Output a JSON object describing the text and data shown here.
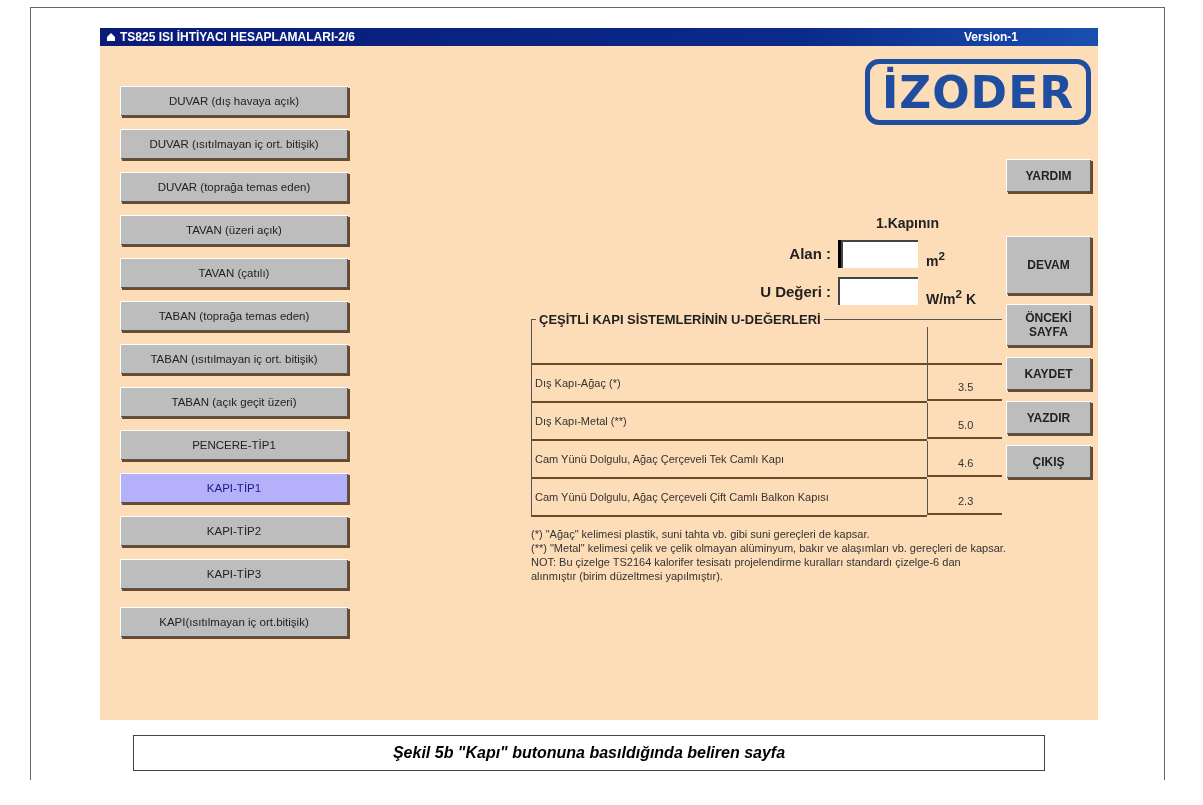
{
  "window": {
    "title": "TS825 ISI İHTİYACI HESAPLAMALARI-2/6",
    "version": "Version-1"
  },
  "logo": {
    "text": "İZODER"
  },
  "nav_buttons": [
    {
      "label": "DUVAR (dış havaya açık)",
      "selected": false
    },
    {
      "label": "DUVAR (ısıtılmayan iç ort. bitişik)",
      "selected": false
    },
    {
      "label": "DUVAR (toprağa temas eden)",
      "selected": false
    },
    {
      "label": "TAVAN (üzeri açık)",
      "selected": false
    },
    {
      "label": "TAVAN (çatılı)",
      "selected": false
    },
    {
      "label": "TABAN (toprağa temas eden)",
      "selected": false
    },
    {
      "label": "TABAN (ısıtılmayan iç ort. bitişik)",
      "selected": false
    },
    {
      "label": "TABAN (açık geçit üzeri)",
      "selected": false
    },
    {
      "label": "PENCERE-TİP1",
      "selected": false
    },
    {
      "label": "KAPI-TİP1",
      "selected": true
    },
    {
      "label": "KAPI-TİP2",
      "selected": false
    },
    {
      "label": "KAPI-TİP3",
      "selected": false
    },
    {
      "label": "KAPI(ısıtılmayan iç ort.bitişik)",
      "selected": false
    }
  ],
  "form": {
    "heading": "1.Kapının",
    "fields": [
      {
        "label": "Alan :",
        "unit": "m$^{2}$",
        "focused": true
      },
      {
        "label": "U Değeri :",
        "unit": "W/m$^{2}$ K",
        "focused": false
      }
    ]
  },
  "u_table": {
    "title": "ÇEŞİTLİ KAPI SİSTEMLERİNİN U-DEĞERLERİ",
    "rows": [
      {
        "name": "Dış Kapı-Ağaç (*)",
        "value": "3.5"
      },
      {
        "name": "Dış Kapı-Metal (**)",
        "value": "5.0"
      },
      {
        "name": "Cam Yünü Dolgulu, Ağaç Çerçeveli Tek Camlı Kapı",
        "value": "4.6"
      },
      {
        "name": "Cam Yünü Dolgulu, Ağaç Çerçeveli Çift Camlı Balkon Kapısı",
        "value": "2.3"
      }
    ],
    "notes": [
      "(*) \"Ağaç\" kelimesi plastik, suni tahta vb. gibi suni gereçleri de kapsar.",
      "(**) \"Metal\" kelimesi çelik ve çelik olmayan alüminyum, bakır ve alaşımları vb. gereçleri de kapsar.",
      "NOT: Bu çizelge TS2164 kalorifer tesisatı projelendirme kuralları standardı çizelge-6 dan alınmıştır (birim düzeltmesi yapılmıştır)."
    ]
  },
  "action_buttons": [
    {
      "label": "YARDIM",
      "kind": "small"
    },
    {
      "label": "DEVAM",
      "kind": "tall"
    },
    {
      "label": "ÖNCEKİ SAYFA",
      "kind": "two-line"
    },
    {
      "label": "KAYDET",
      "kind": "small"
    },
    {
      "label": "YAZDIR",
      "kind": "small"
    },
    {
      "label": "ÇIKIŞ",
      "kind": "small"
    }
  ],
  "caption": "Şekil 5b \"Kapı\" butonuna basıldığında beliren sayfa"
}
